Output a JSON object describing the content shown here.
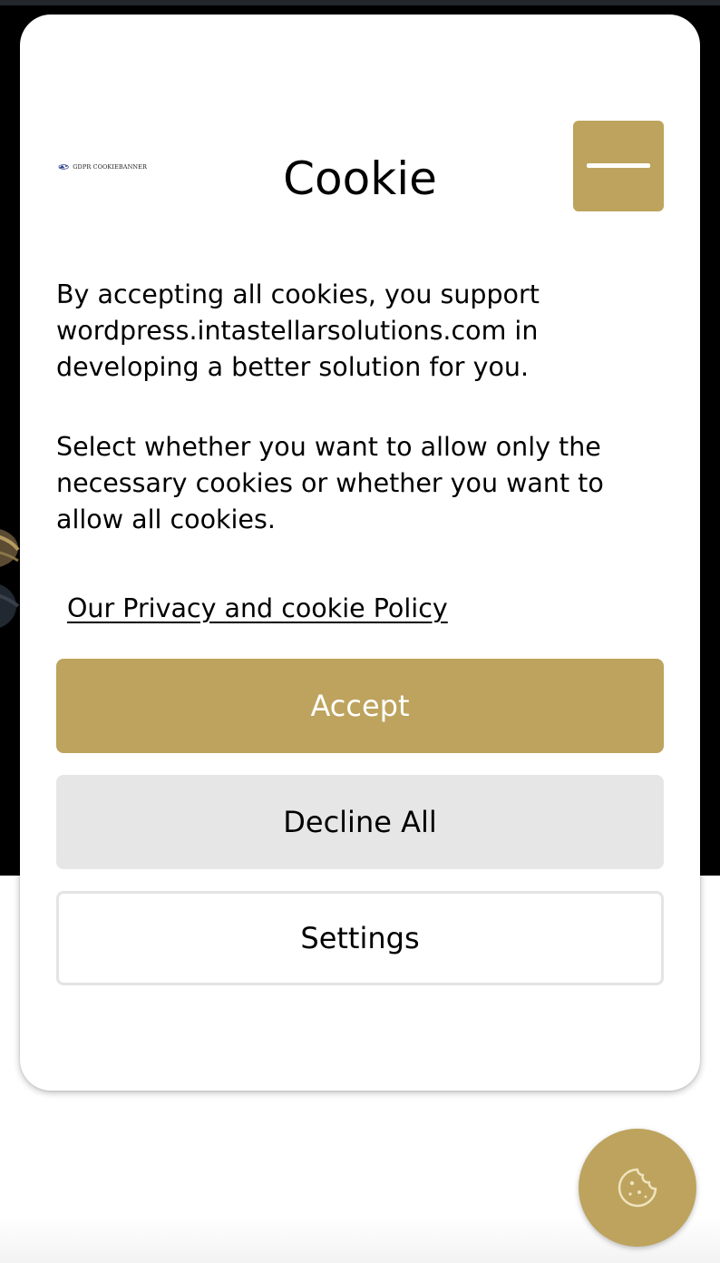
{
  "banner": {
    "logo_text": "GDPR COOKIEBANNER",
    "title": "Cookie",
    "menu_icon": "hamburger-icon",
    "paragraph_1": "By accepting all cookies, you support wordpress.intastellarsolutions.com in developing a better solution for you.",
    "paragraph_2": "Select whether you want to allow only the necessary cookies or whether you want to allow all cookies.",
    "policy_link": "Our Privacy and cookie Policy",
    "buttons": {
      "accept": "Accept",
      "decline": "Decline All",
      "settings": "Settings"
    }
  },
  "floating_button": {
    "icon": "cookie-icon"
  },
  "colors": {
    "accent": "#bda35d",
    "decline_bg": "#e6e6e6",
    "page_dark": "#000000"
  }
}
